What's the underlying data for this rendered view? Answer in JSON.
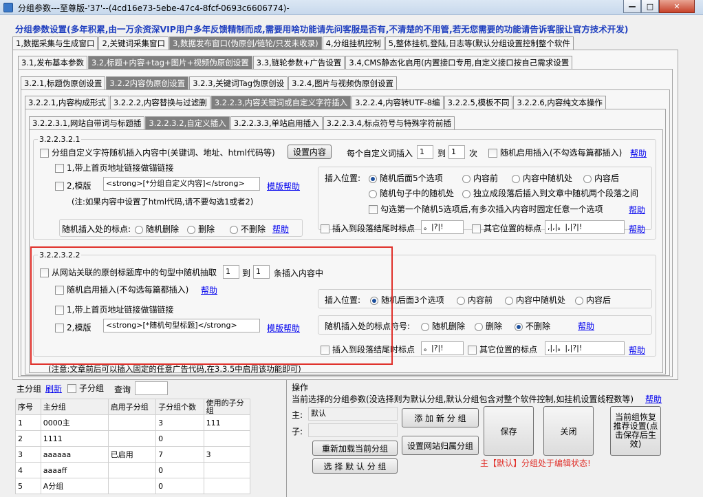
{
  "window": {
    "title": "分组参数---至尊版-'37'--(4cd16e73-5ebe-47c4-8fcf-0693c6606774)-"
  },
  "banner": "分组参数设置(多年积累,由一万余资深VIP用户多年反馈精制而成,需要用啥功能请先问客服是否有,不清楚的不用管,若无您需要的功能请告诉客服让官方技术开发)",
  "tabs1": [
    "1,数据采集与生成窗口",
    "2,关键词采集窗口",
    "3,数据发布窗口(伪原创/链轮/只发未收录)",
    "4,分组挂机控制",
    "5,整体挂机,登陆,日志等(默认分组设置控制整个软件"
  ],
  "tabs2": [
    "3.1,发布基本参数",
    "3.2,标题+内容+tag+图片+视频伪原创设置",
    "3.3,链轮参数+广告设置",
    "3.4,CMS静态化启用(内置接口专用,自定义接口按自己需求设置"
  ],
  "tabs3": [
    "3.2.1,标题伪原创设置",
    "3.2.2内容伪原创设置",
    "3.2.3,关键词Tag伪原创设",
    "3.2.4,图片与视频伪原创设置"
  ],
  "tabs4": [
    "3.2.2.1,内容构成形式",
    "3.2.2.2,内容替换与过滤删",
    "3.2.2.3,内容关键词或自定义字符插入",
    "3.2.2.4,内容转UTF-8编",
    "3.2.2.5,模板不同",
    "3.2.2.6,内容纯文本操作"
  ],
  "tabs5": [
    "3.2.2.3.1,网站自带词与标题插",
    "3.2.2.3.2,自定义插入",
    "3.2.2.3.3,单站启用插入",
    "3.2.2.3.4,标点符号与特殊字符前插"
  ],
  "g1": {
    "label": "3.2.2.3.2.1",
    "main_check": "分组自定义字符随机插入内容中(关键词、地址、html代码等)",
    "set_btn": "设置内容",
    "each_label": "每个自定义词插入",
    "each_from": "1",
    "each_to_label": "到",
    "each_to": "1",
    "each_unit": "次",
    "random_check": "随机启用插入(不勾选每篇都插入)",
    "help": "帮助",
    "link_check": "1,带上首页地址链接做锚链接",
    "tpl_check": "2,模版",
    "tpl_value": "<strong>[*分组自定义内容]</strong>",
    "tpl_help": "模版帮助",
    "note": "(注:如果内容中设置了html代码,请不要勾选1或者2)",
    "punct_label": "随机插入处的标点:",
    "punct_opts": [
      "随机删除",
      "删除",
      "不删除"
    ],
    "pos_label": "插入位置:",
    "pos_opts": [
      "随机后面5个选项",
      "内容前",
      "内容中随机处",
      "内容后",
      "随机句子中的随机处",
      "独立成段落后插入到文章中随机两个段落之间"
    ],
    "fixed_check": "勾选第一个随机5选项后,有多次插入内容时固定任意一个选项",
    "end_check": "插入到段落结尾时标点",
    "end_value": "。|?|!",
    "other_check": "其它位置的标点",
    "other_value": ",|,|。|,|?|!"
  },
  "g2": {
    "label": "3.2.2.3.2.2",
    "main_check": "从网站关联的原创标题库中的句型中随机抽取",
    "from": "1",
    "to_label": "到",
    "to": "1",
    "unit": "条插入内容中",
    "random_check": "随机启用插入(不勾选每篇都插入)",
    "help": "帮助",
    "link_check": "1,带上首页地址链接做锚链接",
    "tpl_check": "2,模版",
    "tpl_value": "<strong>[*随机句型标题]</strong>",
    "tpl_help": "模版帮助",
    "pos_label": "插入位置:",
    "pos_opts": [
      "随机后面3个选项",
      "内容前",
      "内容中随机处",
      "内容后"
    ],
    "punct_label": "随机插入处的标点符号:",
    "punct_opts": [
      "随机删除",
      "删除",
      "不删除"
    ],
    "end_check": "插入到段落结尾时标点",
    "end_value": "。|?|!",
    "other_check": "其它位置的标点",
    "other_value": ",|,|。|,|?|!"
  },
  "footnote": "(注意:文章前后可以插入固定的任意广告代码,在3.3.5中启用该功能即可)",
  "left": {
    "title": "主分组",
    "refresh": "刷新",
    "sub_check": "子分组",
    "query_label": "查询",
    "columns": [
      "序号",
      "主分组",
      "启用子分组",
      "子分组个数",
      "使用的子分组"
    ],
    "rows": [
      [
        "1",
        "0000主",
        "",
        "3",
        "111"
      ],
      [
        "2",
        "1111",
        "",
        "0",
        ""
      ],
      [
        "3",
        "aaaaaa",
        "已启用",
        "7",
        "3"
      ],
      [
        "4",
        "aaaaff",
        "",
        "0",
        ""
      ],
      [
        "5",
        "A分组",
        "",
        "0",
        ""
      ]
    ]
  },
  "ops": {
    "title": "操作",
    "desc": "当前选择的分组参数(没选择则为默认分组,默认分组包含对整个软件控制,如挂机设置线程数等)",
    "help": "帮助",
    "main_label": "主:",
    "main_value": "默认",
    "sub_label": "子:",
    "add_btn": "添 加 新 分 组",
    "reload_btn": "重新加载当前分组",
    "site_btn": "设置网站归属分组",
    "default_btn": "选 择 默 认 分 组",
    "save_btn": "保存",
    "close_btn": "关闭",
    "restore_btn": "当前组恢复推荐设置(点击保存后生效)",
    "status": "主【默认】分组处于编辑状态!"
  }
}
